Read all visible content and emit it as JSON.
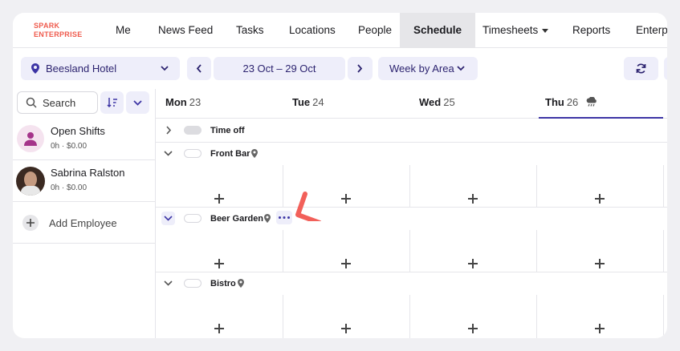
{
  "brand": {
    "line1": "SPARK",
    "line2": "ENTERPRISE",
    "color": "#ef5a4c"
  },
  "nav": {
    "items": [
      "Me",
      "News Feed",
      "Tasks",
      "Locations",
      "People",
      "Schedule",
      "Timesheets",
      "Reports",
      "Enterprise"
    ],
    "active": "Schedule"
  },
  "toolbar": {
    "location": "Beesland Hotel",
    "date_range": "23 Oct – 29 Oct",
    "view": "Week by Area"
  },
  "search": {
    "label": "Search"
  },
  "days": [
    {
      "name": "Mon",
      "num": "23"
    },
    {
      "name": "Tue",
      "num": "24"
    },
    {
      "name": "Wed",
      "num": "25"
    },
    {
      "name": "Thu",
      "num": "26"
    }
  ],
  "employees": [
    {
      "name": "Open Shifts",
      "sub": "0h · $0.00",
      "avatar": "open-shift"
    },
    {
      "name": "Sabrina Ralston",
      "sub": "0h · $0.00",
      "avatar": "photo"
    }
  ],
  "add_employee": "Add Employee",
  "areas": [
    {
      "name": "Time off"
    },
    {
      "name": "Front Bar"
    },
    {
      "name": "Beer Garden"
    },
    {
      "name": "Bistro"
    }
  ],
  "colors": {
    "accent": "#3d35a5",
    "pill_bg": "#eeeefa",
    "arrow": "#f2605a"
  }
}
